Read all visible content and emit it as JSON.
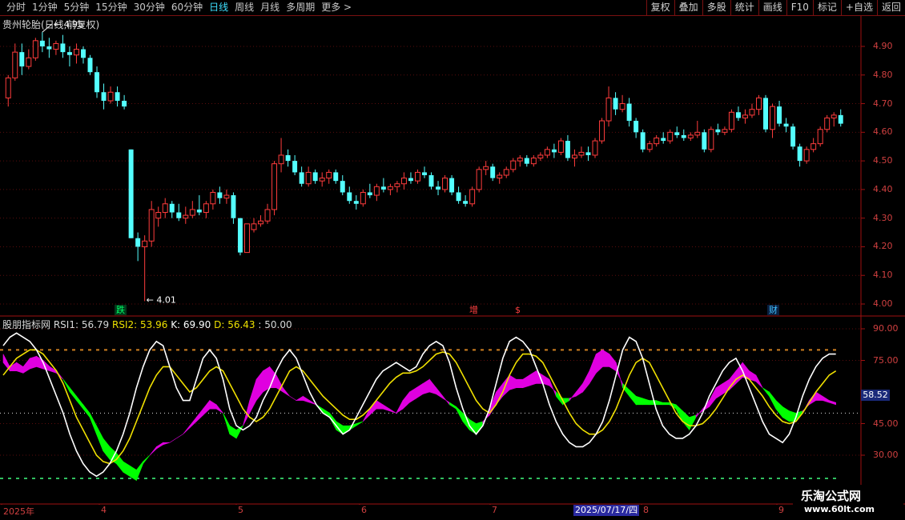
{
  "toolbar": {
    "periods": [
      "分时",
      "1分钟",
      "5分钟",
      "15分钟",
      "30分钟",
      "60分钟",
      "日线",
      "周线",
      "月线",
      "多周期",
      "更多 >"
    ],
    "active_period": "日线",
    "actions": [
      "复权",
      "叠加",
      "多股",
      "统计",
      "画线",
      "F10",
      "标记",
      "+自选",
      "返回"
    ]
  },
  "stock": {
    "title": "贵州轮胎(日线,前复权)",
    "high_marker": "4.95",
    "low_marker": "4.01"
  },
  "indicator": {
    "name": "股朋指标网",
    "rsi1_label": "RSI1: 56.79",
    "rsi2_label": "RSI2: 53.96",
    "k_label": "K: 69.90",
    "d_label": "D: 56.43",
    "extra_label": ": 50.00",
    "current_value": "58.52",
    "colors": {
      "rsi_up": "#e000e0",
      "rsi_down": "#00ff00",
      "k": "#ffffff",
      "d": "#f0e000"
    }
  },
  "price_axis": [
    "4.90",
    "4.80",
    "4.70",
    "4.60",
    "4.50",
    "4.40",
    "4.30",
    "4.20",
    "4.10",
    "4.00"
  ],
  "ind_axis": [
    "90.00",
    "75.00",
    "58.52",
    "45.00",
    "30.00"
  ],
  "events": [
    {
      "label": "跌",
      "color": "#00ff66",
      "bg": "#003a1a"
    },
    {
      "label": "增",
      "color": "#ff4040",
      "bg": "#000000"
    },
    {
      "label": "$",
      "color": "#ff4040",
      "bg": "#000000"
    },
    {
      "label": "财",
      "color": "#40c0ff",
      "bg": "#0a2040"
    }
  ],
  "x_axis": {
    "labels": [
      "2025年",
      "4",
      "5",
      "6",
      "7",
      "8",
      "9"
    ],
    "crosshair_date": "2025/07/17/四"
  },
  "watermark": {
    "line1": "乐淘公式网",
    "line2": "www.60lt.com"
  },
  "chart_data": {
    "type": "candlestick",
    "series_note": "daily candles, approximate",
    "price_range": [
      4.0,
      4.95
    ],
    "candles": [
      [
        4.72,
        4.8,
        4.69,
        4.79
      ],
      [
        4.79,
        4.91,
        4.78,
        4.88
      ],
      [
        4.88,
        4.91,
        4.8,
        4.83
      ],
      [
        4.83,
        4.89,
        4.82,
        4.86
      ],
      [
        4.86,
        4.93,
        4.85,
        4.92
      ],
      [
        4.92,
        4.95,
        4.88,
        4.9
      ],
      [
        4.9,
        4.93,
        4.86,
        4.89
      ],
      [
        4.89,
        4.92,
        4.87,
        4.91
      ],
      [
        4.91,
        4.94,
        4.86,
        4.88
      ],
      [
        4.88,
        4.9,
        4.83,
        4.87
      ],
      [
        4.87,
        4.91,
        4.84,
        4.89
      ],
      [
        4.89,
        4.9,
        4.84,
        4.86
      ],
      [
        4.86,
        4.87,
        4.8,
        4.81
      ],
      [
        4.81,
        4.83,
        4.72,
        4.74
      ],
      [
        4.74,
        4.77,
        4.68,
        4.71
      ],
      [
        4.71,
        4.76,
        4.7,
        4.74
      ],
      [
        4.74,
        4.76,
        4.69,
        4.71
      ],
      [
        4.71,
        4.73,
        4.68,
        4.69
      ],
      [
        4.54,
        4.54,
        4.23,
        4.23
      ],
      [
        4.23,
        4.25,
        4.15,
        4.2
      ],
      [
        4.2,
        4.24,
        4.01,
        4.22
      ],
      [
        4.22,
        4.36,
        4.2,
        4.33
      ],
      [
        4.3,
        4.34,
        4.27,
        4.32
      ],
      [
        4.32,
        4.37,
        4.3,
        4.35
      ],
      [
        4.35,
        4.36,
        4.3,
        4.32
      ],
      [
        4.32,
        4.35,
        4.29,
        4.3
      ],
      [
        4.3,
        4.34,
        4.28,
        4.31
      ],
      [
        4.31,
        4.36,
        4.3,
        4.33
      ],
      [
        4.33,
        4.38,
        4.31,
        4.32
      ],
      [
        4.32,
        4.36,
        4.3,
        4.35
      ],
      [
        4.35,
        4.4,
        4.33,
        4.39
      ],
      [
        4.39,
        4.41,
        4.35,
        4.37
      ],
      [
        4.37,
        4.4,
        4.35,
        4.38
      ],
      [
        4.38,
        4.39,
        4.28,
        4.3
      ],
      [
        4.3,
        4.3,
        4.17,
        4.18
      ],
      [
        4.18,
        4.28,
        4.18,
        4.28
      ],
      [
        4.26,
        4.3,
        4.25,
        4.28
      ],
      [
        4.28,
        4.31,
        4.27,
        4.29
      ],
      [
        4.29,
        4.35,
        4.28,
        4.33
      ],
      [
        4.33,
        4.5,
        4.31,
        4.49
      ],
      [
        4.49,
        4.58,
        4.46,
        4.52
      ],
      [
        4.52,
        4.54,
        4.48,
        4.5
      ],
      [
        4.5,
        4.52,
        4.45,
        4.46
      ],
      [
        4.46,
        4.48,
        4.41,
        4.42
      ],
      [
        4.42,
        4.48,
        4.41,
        4.46
      ],
      [
        4.46,
        4.47,
        4.42,
        4.43
      ],
      [
        4.43,
        4.46,
        4.41,
        4.44
      ],
      [
        4.44,
        4.47,
        4.42,
        4.46
      ],
      [
        4.46,
        4.47,
        4.42,
        4.43
      ],
      [
        4.43,
        4.45,
        4.38,
        4.39
      ],
      [
        4.39,
        4.41,
        4.35,
        4.36
      ],
      [
        4.36,
        4.38,
        4.33,
        4.35
      ],
      [
        4.35,
        4.4,
        4.34,
        4.39
      ],
      [
        4.39,
        4.42,
        4.37,
        4.38
      ],
      [
        4.38,
        4.42,
        4.36,
        4.41
      ],
      [
        4.41,
        4.44,
        4.39,
        4.4
      ],
      [
        4.4,
        4.42,
        4.38,
        4.41
      ],
      [
        4.41,
        4.43,
        4.39,
        4.42
      ],
      [
        4.42,
        4.46,
        4.4,
        4.44
      ],
      [
        4.44,
        4.46,
        4.42,
        4.43
      ],
      [
        4.43,
        4.47,
        4.42,
        4.46
      ],
      [
        4.46,
        4.48,
        4.44,
        4.45
      ],
      [
        4.45,
        4.46,
        4.4,
        4.41
      ],
      [
        4.41,
        4.43,
        4.38,
        4.4
      ],
      [
        4.4,
        4.45,
        4.39,
        4.44
      ],
      [
        4.44,
        4.45,
        4.38,
        4.39
      ],
      [
        4.39,
        4.41,
        4.35,
        4.36
      ],
      [
        4.36,
        4.38,
        4.34,
        4.35
      ],
      [
        4.35,
        4.41,
        4.34,
        4.4
      ],
      [
        4.4,
        4.48,
        4.39,
        4.47
      ],
      [
        4.47,
        4.5,
        4.45,
        4.48
      ],
      [
        4.48,
        4.49,
        4.43,
        4.44
      ],
      [
        4.44,
        4.46,
        4.42,
        4.45
      ],
      [
        4.45,
        4.48,
        4.44,
        4.47
      ],
      [
        4.47,
        4.51,
        4.46,
        4.5
      ],
      [
        4.5,
        4.52,
        4.48,
        4.51
      ],
      [
        4.51,
        4.52,
        4.48,
        4.49
      ],
      [
        4.49,
        4.52,
        4.48,
        4.51
      ],
      [
        4.51,
        4.53,
        4.5,
        4.52
      ],
      [
        4.52,
        4.55,
        4.51,
        4.54
      ],
      [
        4.54,
        4.56,
        4.51,
        4.53
      ],
      [
        4.53,
        4.58,
        4.52,
        4.57
      ],
      [
        4.57,
        4.59,
        4.5,
        4.51
      ],
      [
        4.51,
        4.54,
        4.48,
        4.52
      ],
      [
        4.52,
        4.55,
        4.51,
        4.53
      ],
      [
        4.53,
        4.55,
        4.5,
        4.52
      ],
      [
        4.52,
        4.58,
        4.51,
        4.57
      ],
      [
        4.57,
        4.65,
        4.56,
        4.64
      ],
      [
        4.64,
        4.76,
        4.62,
        4.72
      ],
      [
        4.72,
        4.74,
        4.66,
        4.68
      ],
      [
        4.68,
        4.73,
        4.67,
        4.7
      ],
      [
        4.7,
        4.72,
        4.62,
        4.64
      ],
      [
        4.64,
        4.65,
        4.58,
        4.6
      ],
      [
        4.6,
        4.61,
        4.53,
        4.54
      ],
      [
        4.54,
        4.57,
        4.53,
        4.56
      ],
      [
        4.56,
        4.59,
        4.55,
        4.58
      ],
      [
        4.58,
        4.6,
        4.56,
        4.57
      ],
      [
        4.57,
        4.61,
        4.56,
        4.6
      ],
      [
        4.6,
        4.62,
        4.58,
        4.59
      ],
      [
        4.59,
        4.61,
        4.57,
        4.58
      ],
      [
        4.58,
        4.6,
        4.57,
        4.59
      ],
      [
        4.59,
        4.64,
        4.58,
        4.6
      ],
      [
        4.6,
        4.61,
        4.53,
        4.54
      ],
      [
        4.54,
        4.62,
        4.53,
        4.61
      ],
      [
        4.61,
        4.63,
        4.59,
        4.6
      ],
      [
        4.6,
        4.62,
        4.59,
        4.61
      ],
      [
        4.61,
        4.68,
        4.6,
        4.67
      ],
      [
        4.67,
        4.69,
        4.64,
        4.65
      ],
      [
        4.65,
        4.68,
        4.63,
        4.66
      ],
      [
        4.66,
        4.7,
        4.65,
        4.68
      ],
      [
        4.68,
        4.73,
        4.66,
        4.72
      ],
      [
        4.72,
        4.73,
        4.6,
        4.61
      ],
      [
        4.61,
        4.7,
        4.58,
        4.69
      ],
      [
        4.69,
        4.71,
        4.62,
        4.63
      ],
      [
        4.63,
        4.65,
        4.6,
        4.62
      ],
      [
        4.62,
        4.63,
        4.54,
        4.55
      ],
      [
        4.55,
        4.56,
        4.48,
        4.5
      ],
      [
        4.5,
        4.55,
        4.49,
        4.54
      ],
      [
        4.54,
        4.58,
        4.53,
        4.56
      ],
      [
        4.56,
        4.62,
        4.55,
        4.61
      ],
      [
        4.61,
        4.66,
        4.6,
        4.65
      ],
      [
        4.65,
        4.67,
        4.62,
        4.66
      ],
      [
        4.66,
        4.68,
        4.62,
        4.63
      ]
    ]
  }
}
